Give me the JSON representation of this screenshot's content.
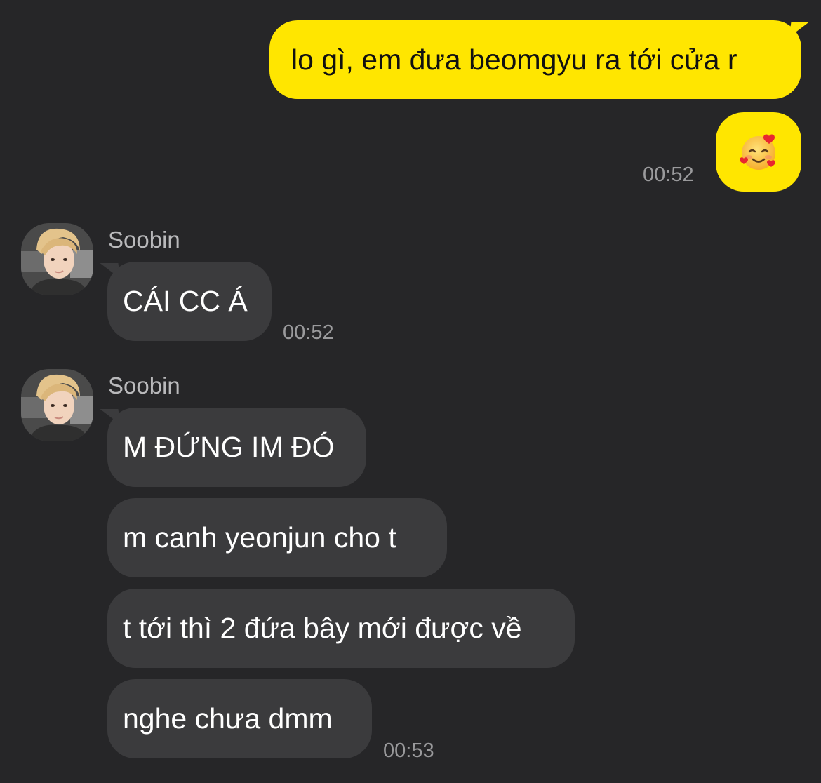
{
  "outgoing": {
    "message_1": "lo gì, em đưa beomgyu ra tới cửa r",
    "message_2_emoji": "smiling-face-with-hearts-icon",
    "time": "00:52"
  },
  "incoming_group_1": {
    "sender": "Soobin",
    "message_1": "CÁI CC Á",
    "time": "00:52"
  },
  "incoming_group_2": {
    "sender": "Soobin",
    "message_1": "M ĐỨNG IM ĐÓ",
    "message_2": "m canh yeonjun cho t",
    "message_3": "t tới thì 2 đứa bây mới được về",
    "message_4": "nghe chưa dmm",
    "time": "00:53"
  },
  "colors": {
    "background": "#262628",
    "outgoing_bubble": "#ffe600",
    "incoming_bubble": "#3b3b3d",
    "timestamp": "#9a9a9c",
    "sender_name": "#b9b9bb"
  }
}
